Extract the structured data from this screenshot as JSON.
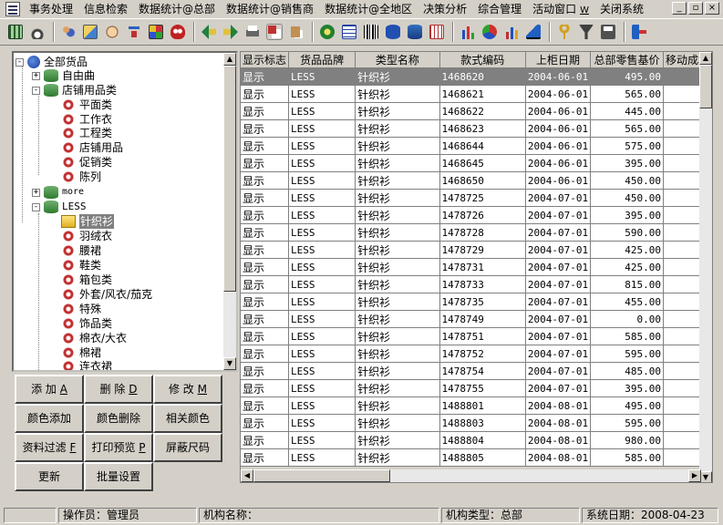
{
  "menu": {
    "items": [
      "事务处理",
      "信息检索",
      "数据统计@总部",
      "数据统计@销售商",
      "数据统计@全地区",
      "决策分析",
      "综合管理",
      "活动窗口",
      "关闭系统"
    ],
    "active_window_hotkey": "W",
    "window_controls": [
      "_",
      "▫",
      "×"
    ]
  },
  "toolbar": {
    "icons": [
      "grid-icon",
      "bell-icon",
      "users-icon",
      "cards-icon",
      "hand-icon",
      "filter-icon",
      "palette-icon",
      "mask-icon",
      "back-icon",
      "forward-icon",
      "printer-icon",
      "copy-icon",
      "paste-icon",
      "money-icon",
      "table-icon",
      "barcode-icon",
      "disk-icon",
      "stack-icon",
      "sheet-icon",
      "bar-chart-icon",
      "pie-chart-icon",
      "column-chart-icon",
      "area-chart-icon",
      "key-icon",
      "funnel-icon",
      "save-icon",
      "exit-icon"
    ]
  },
  "tree": {
    "root": "全部货品",
    "nodes": [
      {
        "label": "自由曲",
        "level": 1,
        "type": "db",
        "expander": "+"
      },
      {
        "label": "店铺用品类",
        "level": 1,
        "type": "db",
        "expander": "-"
      },
      {
        "label": "平面类",
        "level": 2,
        "type": "gear"
      },
      {
        "label": "工作衣",
        "level": 2,
        "type": "gear"
      },
      {
        "label": "工程类",
        "level": 2,
        "type": "gear"
      },
      {
        "label": "店铺用品",
        "level": 2,
        "type": "gear"
      },
      {
        "label": "促销类",
        "level": 2,
        "type": "gear"
      },
      {
        "label": "陈列",
        "level": 2,
        "type": "gear"
      },
      {
        "label": "more",
        "level": 1,
        "type": "db",
        "expander": "+"
      },
      {
        "label": "LESS",
        "level": 1,
        "type": "db",
        "expander": "-"
      },
      {
        "label": "针织衫",
        "level": 2,
        "type": "folder",
        "selected": true
      },
      {
        "label": "羽绒衣",
        "level": 2,
        "type": "gear"
      },
      {
        "label": "腰裙",
        "level": 2,
        "type": "gear"
      },
      {
        "label": "鞋类",
        "level": 2,
        "type": "gear"
      },
      {
        "label": "箱包类",
        "level": 2,
        "type": "gear"
      },
      {
        "label": "外套/风衣/茄克",
        "level": 2,
        "type": "gear"
      },
      {
        "label": "特殊",
        "level": 2,
        "type": "gear"
      },
      {
        "label": "饰品类",
        "level": 2,
        "type": "gear"
      },
      {
        "label": "棉衣/大衣",
        "level": 2,
        "type": "gear"
      },
      {
        "label": "棉裙",
        "level": 2,
        "type": "gear"
      },
      {
        "label": "连衣裙",
        "level": 2,
        "type": "gear"
      }
    ]
  },
  "buttons": {
    "add": {
      "label": "添 加",
      "key": "A"
    },
    "delete": {
      "label": "删 除",
      "key": "D"
    },
    "modify": {
      "label": "修 改",
      "key": "M"
    },
    "color_add": "颜色添加",
    "color_delete": "颜色删除",
    "related_color": "相关颜色",
    "data_filter": {
      "label": "资料过滤",
      "key": "F"
    },
    "print_preview": {
      "label": "打印预览",
      "key": "P"
    },
    "hide_size": "屏蔽尺码",
    "refresh": "更新",
    "batch_settings": "批量设置"
  },
  "grid": {
    "columns": [
      "显示标志",
      "货品品牌",
      "类型名称",
      "款式编码",
      "上柜日期",
      "总部零售基价",
      "移动成本"
    ],
    "rows": [
      [
        "显示",
        "LESS",
        "针织衫",
        "1468620",
        "2004-06-01",
        "495.00",
        ""
      ],
      [
        "显示",
        "LESS",
        "针织衫",
        "1468621",
        "2004-06-01",
        "565.00",
        ""
      ],
      [
        "显示",
        "LESS",
        "针织衫",
        "1468622",
        "2004-06-01",
        "445.00",
        ""
      ],
      [
        "显示",
        "LESS",
        "针织衫",
        "1468623",
        "2004-06-01",
        "565.00",
        ""
      ],
      [
        "显示",
        "LESS",
        "针织衫",
        "1468644",
        "2004-06-01",
        "575.00",
        ""
      ],
      [
        "显示",
        "LESS",
        "针织衫",
        "1468645",
        "2004-06-01",
        "395.00",
        ""
      ],
      [
        "显示",
        "LESS",
        "针织衫",
        "1468650",
        "2004-06-01",
        "450.00",
        ""
      ],
      [
        "显示",
        "LESS",
        "针织衫",
        "1478725",
        "2004-07-01",
        "450.00",
        ""
      ],
      [
        "显示",
        "LESS",
        "针织衫",
        "1478726",
        "2004-07-01",
        "395.00",
        ""
      ],
      [
        "显示",
        "LESS",
        "针织衫",
        "1478728",
        "2004-07-01",
        "590.00",
        ""
      ],
      [
        "显示",
        "LESS",
        "针织衫",
        "1478729",
        "2004-07-01",
        "425.00",
        ""
      ],
      [
        "显示",
        "LESS",
        "针织衫",
        "1478731",
        "2004-07-01",
        "425.00",
        ""
      ],
      [
        "显示",
        "LESS",
        "针织衫",
        "1478733",
        "2004-07-01",
        "815.00",
        ""
      ],
      [
        "显示",
        "LESS",
        "针织衫",
        "1478735",
        "2004-07-01",
        "455.00",
        ""
      ],
      [
        "显示",
        "LESS",
        "针织衫",
        "1478749",
        "2004-07-01",
        "0.00",
        ""
      ],
      [
        "显示",
        "LESS",
        "针织衫",
        "1478751",
        "2004-07-01",
        "585.00",
        ""
      ],
      [
        "显示",
        "LESS",
        "针织衫",
        "1478752",
        "2004-07-01",
        "595.00",
        ""
      ],
      [
        "显示",
        "LESS",
        "针织衫",
        "1478754",
        "2004-07-01",
        "485.00",
        ""
      ],
      [
        "显示",
        "LESS",
        "针织衫",
        "1478755",
        "2004-07-01",
        "395.00",
        ""
      ],
      [
        "显示",
        "LESS",
        "针织衫",
        "1488801",
        "2004-08-01",
        "495.00",
        ""
      ],
      [
        "显示",
        "LESS",
        "针织衫",
        "1488803",
        "2004-08-01",
        "595.00",
        ""
      ],
      [
        "显示",
        "LESS",
        "针织衫",
        "1488804",
        "2004-08-01",
        "980.00",
        ""
      ],
      [
        "显示",
        "LESS",
        "针织衫",
        "1488805",
        "2004-08-01",
        "585.00",
        ""
      ]
    ],
    "selected_row": 0
  },
  "status": {
    "operator": "操作员：管理员",
    "org_name": "机构名称：",
    "org_type": "机构类型：总部",
    "system_date": "系统日期：2008-04-23"
  }
}
